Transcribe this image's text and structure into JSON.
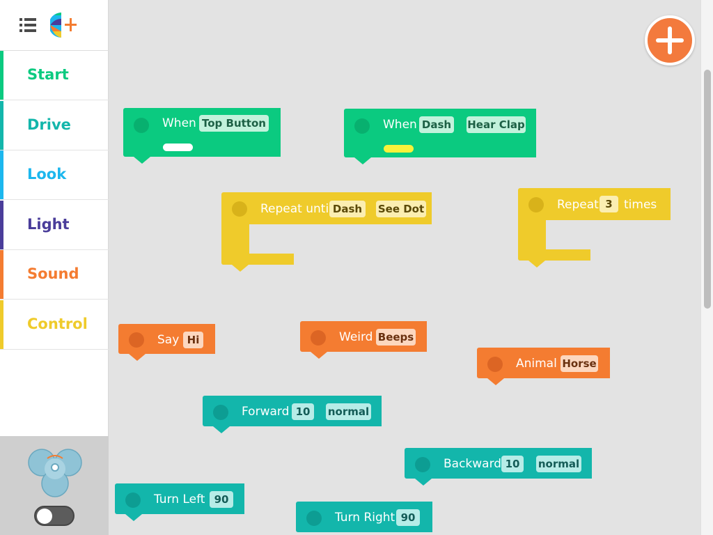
{
  "sidebar": {
    "categories": [
      {
        "label": "Start",
        "color": "#0bca80"
      },
      {
        "label": "Drive",
        "color": "#13b6ab"
      },
      {
        "label": "Look",
        "color": "#1cb7ee"
      },
      {
        "label": "Light",
        "color": "#4a3d9a"
      },
      {
        "label": "Sound",
        "color": "#f47c31"
      },
      {
        "label": "Control",
        "color": "#efcb2b"
      }
    ],
    "menu_icon": "list-icon",
    "logo_icon": "app-logo-icon",
    "robot_icon": "dash-robot-icon",
    "robot_toggle": "off"
  },
  "canvas": {
    "add_icon": "plus-icon",
    "blocks": {
      "when_top": {
        "label": "When",
        "param": "Top Button",
        "swatch_color": "#ffffff"
      },
      "when_dash": {
        "label": "When",
        "param1": "Dash",
        "param2": "Hear Clap",
        "swatch_color": "#f8f23a"
      },
      "repeat_until": {
        "label": "Repeat until",
        "param1": "Dash",
        "param2": "See Dot"
      },
      "repeat_times": {
        "label": "Repeat",
        "count": "3",
        "suffix": "times"
      },
      "say": {
        "label": "Say",
        "param": "Hi"
      },
      "weird": {
        "label": "Weird",
        "param": "Beeps"
      },
      "animal": {
        "label": "Animal",
        "param": "Horse"
      },
      "forward": {
        "label": "Forward",
        "distance": "10",
        "speed": "normal"
      },
      "backward": {
        "label": "Backward",
        "distance": "10",
        "speed": "normal"
      },
      "turn_left": {
        "label": "Turn Left",
        "degrees": "90"
      },
      "turn_right": {
        "label": "Turn Right",
        "degrees": "90"
      }
    }
  }
}
